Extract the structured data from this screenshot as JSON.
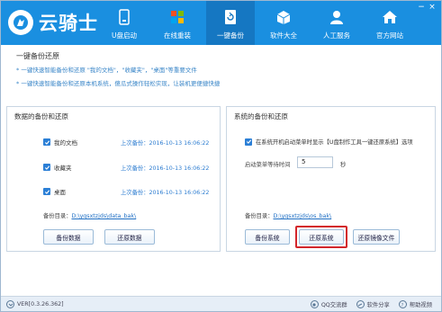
{
  "app": {
    "name": "云骑士"
  },
  "window": {
    "minimize": "−",
    "close": "×"
  },
  "nav": [
    {
      "label": "U盘启动",
      "icon": "usb-drive-icon",
      "active": false
    },
    {
      "label": "在线重装",
      "icon": "windows-icon",
      "active": false
    },
    {
      "label": "一键备份",
      "icon": "backup-restore-icon",
      "active": true
    },
    {
      "label": "软件大全",
      "icon": "software-box-icon",
      "active": false
    },
    {
      "label": "人工服务",
      "icon": "customer-service-icon",
      "active": false
    },
    {
      "label": "官方网站",
      "icon": "home-icon",
      "active": false
    }
  ],
  "intro": {
    "title": "一键备份还原",
    "line1": "* 一键快速智能备份和还原 \"我的文档\"，\"收藏夹\"，\"桌面\"等重要文件",
    "line2": "* 一键快速智能备份和还原本机系统，傻瓜式操作轻松实现，让装机更便捷快捷"
  },
  "data_panel": {
    "title": "数据的备份和还原",
    "items": [
      {
        "label": "我的文档",
        "checked": true,
        "last_backup": "上次备份：2016-10-13 16:06:22"
      },
      {
        "label": "收藏夹",
        "checked": true,
        "last_backup": "上次备份：2016-10-13 16:06:22"
      },
      {
        "label": "桌面",
        "checked": true,
        "last_backup": "上次备份：2016-10-13 16:06:22"
      }
    ],
    "dir_label": "备份目录：",
    "dir_path": "D:\\yqsxtzjds\\data_bak\\",
    "backup_button": "备份数据",
    "restore_button": "还原数据"
  },
  "system_panel": {
    "title": "系统的备份和还原",
    "boot_option": {
      "checked": true,
      "label": "在系统开机启动菜单时显示【U盘制作工具一键还原系统】选项"
    },
    "wait_label": "启动菜单等待时间",
    "wait_value": "5",
    "wait_unit": "秒",
    "dir_label": "备份目录：",
    "dir_path": "D:\\yqsxtzjds\\os_bak\\",
    "backup_button": "备份系统",
    "restore_button": "还原系统",
    "restore_image_button": "还原镜像文件",
    "highlight_color": "#d3252b"
  },
  "footer": {
    "version": "VER[0.3.26.362]",
    "links": [
      {
        "label": "QQ交流群",
        "icon": "qq-icon"
      },
      {
        "label": "软件分享",
        "icon": "share-icon"
      },
      {
        "label": "帮助视频",
        "icon": "help-icon"
      }
    ]
  },
  "colors": {
    "brand": "#1a8fe0",
    "nav_active": "#1577c2",
    "link": "#2a7bd0"
  }
}
